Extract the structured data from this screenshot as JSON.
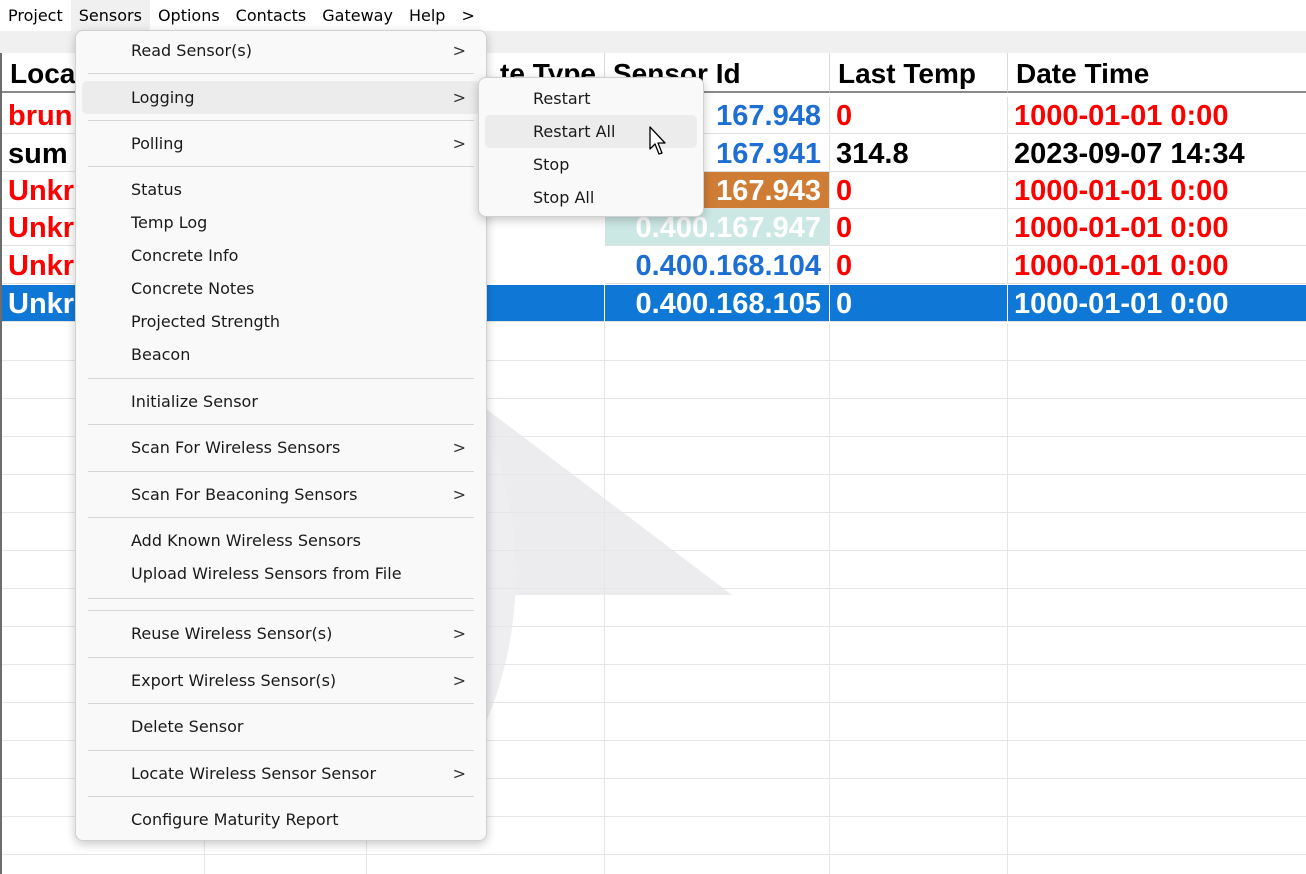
{
  "menubar": {
    "items": [
      "Project",
      "Sensors",
      "Options",
      "Contacts",
      "Gateway",
      "Help",
      ">"
    ],
    "active": "Sensors"
  },
  "grid": {
    "headers": [
      "Loca",
      "te Type",
      "Sensor Id",
      "Last Temp",
      "Date Time"
    ],
    "rows": [
      {
        "location": "brun",
        "sensor_id": "167.948",
        "last_temp": "0",
        "date_time": "1000-01-01 0:00"
      },
      {
        "location": "sum",
        "sensor_id": "167.941",
        "last_temp": "314.8",
        "date_time": "2023-09-07 14:34"
      },
      {
        "location": "Unkr",
        "sensor_id": "167.943",
        "last_temp": "0",
        "date_time": "1000-01-01 0:00"
      },
      {
        "location": "Unkr",
        "sensor_id": "0.400.167.947",
        "last_temp": "0",
        "date_time": "1000-01-01 0:00"
      },
      {
        "location": "Unkr",
        "sensor_id": "0.400.168.104",
        "last_temp": "0",
        "date_time": "1000-01-01 0:00"
      },
      {
        "location": "Unkr",
        "sensor_id": "0.400.168.105",
        "last_temp": "0",
        "date_time": "1000-01-01 0:00"
      }
    ],
    "colors": {
      "red": "#ff0000",
      "blue": "#1e6fd4",
      "orange": "#cf7d35",
      "mint": "#cce8e4",
      "selected": "#0f78d7"
    }
  },
  "sensors_menu": {
    "items": [
      {
        "label": "Read Sensor(s)",
        "submenu": true
      },
      {
        "label": "Logging",
        "submenu": true
      },
      {
        "label": "Polling",
        "submenu": true
      },
      {
        "label": "Status"
      },
      {
        "label": "Temp Log"
      },
      {
        "label": "Concrete Info"
      },
      {
        "label": "Concrete Notes"
      },
      {
        "label": "Projected Strength"
      },
      {
        "label": "Beacon"
      },
      {
        "label": "Initialize Sensor"
      },
      {
        "label": "Scan For Wireless Sensors",
        "submenu": true
      },
      {
        "label": "Scan For Beaconing Sensors",
        "submenu": true
      },
      {
        "label": "Add Known Wireless Sensors"
      },
      {
        "label": "Upload Wireless Sensors from File"
      },
      {
        "label": "Reuse Wireless Sensor(s)",
        "submenu": true
      },
      {
        "label": "Export Wireless Sensor(s)",
        "submenu": true
      },
      {
        "label": "Delete Sensor"
      },
      {
        "label": "Locate Wireless Sensor Sensor",
        "submenu": true
      },
      {
        "label": "Configure Maturity Report"
      }
    ],
    "chevron": ">"
  },
  "logging_submenu": {
    "items": [
      "Restart",
      "Restart All",
      "Stop",
      "Stop All"
    ],
    "hovered": "Restart All"
  }
}
